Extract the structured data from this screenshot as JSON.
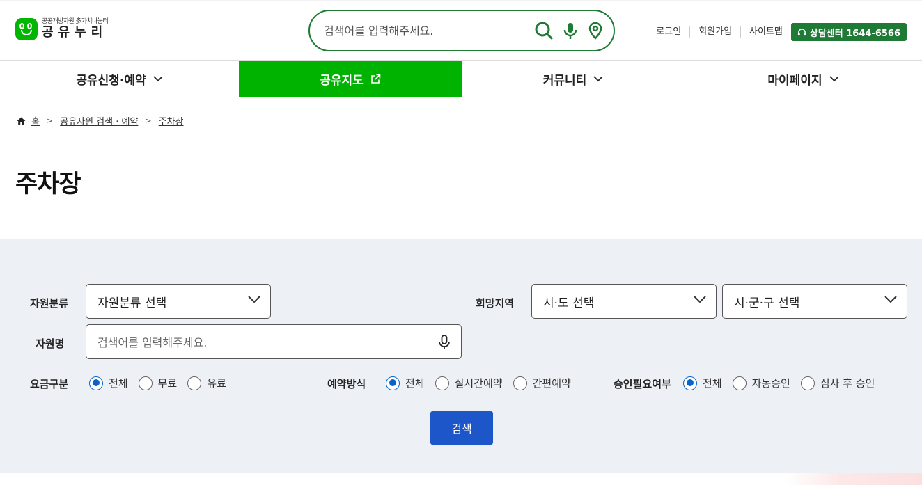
{
  "header": {
    "logo_sub": "공공개방자원 多가치나눔터",
    "logo_main": "공유누리",
    "search_placeholder": "검색어를 입력해주세요.",
    "util_links": [
      "로그인",
      "회원가입",
      "사이트맵"
    ],
    "center_label": "상담센터 1644-6566"
  },
  "gnb": {
    "items": [
      "공유신청·예약",
      "공유지도",
      "커뮤니티",
      "마이페이지"
    ],
    "active_index": 1
  },
  "breadcrumb": {
    "home": "홈",
    "items": [
      "공유자원 검색 · 예약",
      "주차장"
    ]
  },
  "page_title": "주차장",
  "filter": {
    "resource_type_label": "자원분류",
    "resource_type_value": "자원분류 선택",
    "region_label": "희망지역",
    "sido_value": "시·도 선택",
    "sigungu_value": "시·군·구 선택",
    "resource_name_label": "자원명",
    "resource_name_placeholder": "검색어를 입력해주세요.",
    "fee_label": "요금구분",
    "fee_options": [
      "전체",
      "무료",
      "유료"
    ],
    "fee_selected": 0,
    "reserve_label": "예약방식",
    "reserve_options": [
      "전체",
      "실시간예약",
      "간편예약"
    ],
    "reserve_selected": 0,
    "approval_label": "승인필요여부",
    "approval_options": [
      "전체",
      "자동승인",
      "심사 후 승인"
    ],
    "approval_selected": 0,
    "search_button": "검색"
  },
  "colors": {
    "brand_green": "#00b300",
    "dark_green": "#1e7a35",
    "primary_blue": "#1c56c8",
    "radio_blue": "#0a64c8",
    "filter_bg": "#edf0f4"
  }
}
